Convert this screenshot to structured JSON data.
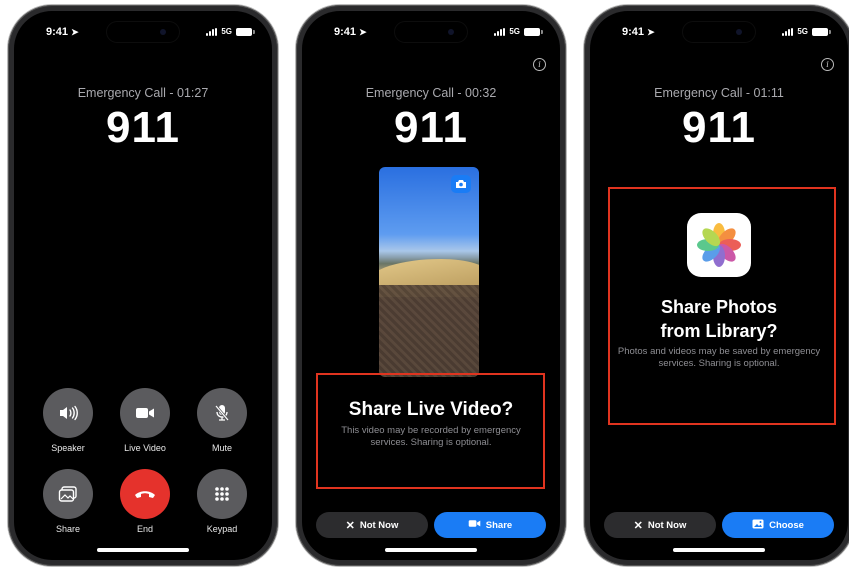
{
  "phones": [
    {
      "status": {
        "time": "9:41",
        "network": "5G"
      },
      "call_label": "Emergency Call - 01:27",
      "number": "911",
      "controls": [
        {
          "label": "Speaker",
          "icon": "speaker-icon"
        },
        {
          "label": "Live Video",
          "icon": "video-camera-icon"
        },
        {
          "label": "Mute",
          "icon": "mute-icon"
        },
        {
          "label": "Share",
          "icon": "photos-share-icon"
        },
        {
          "label": "End",
          "icon": "end-call-icon"
        },
        {
          "label": "Keypad",
          "icon": "keypad-icon"
        }
      ]
    },
    {
      "status": {
        "time": "9:41",
        "network": "5G"
      },
      "call_label": "Emergency Call - 00:32",
      "number": "911",
      "prompt_title": "Share Live Video?",
      "prompt_body": "This video may be recorded by emergency services. Sharing is optional.",
      "not_now_label": "Not Now",
      "action_label": "Share",
      "action_icon": "video-camera-icon"
    },
    {
      "status": {
        "time": "9:41",
        "network": "5G"
      },
      "call_label": "Emergency Call - 01:11",
      "number": "911",
      "prompt_title_line1": "Share Photos",
      "prompt_title_line2": "from Library?",
      "prompt_body": "Photos and videos may be saved by emergency services. Sharing is optional.",
      "not_now_label": "Not Now",
      "action_label": "Choose",
      "action_icon": "photo-icon"
    }
  ],
  "colors": {
    "end_call": "#e5322c",
    "accent_blue": "#1a7cf5",
    "highlight_box": "#e0341f",
    "control_gray": "#5b5b5e"
  }
}
